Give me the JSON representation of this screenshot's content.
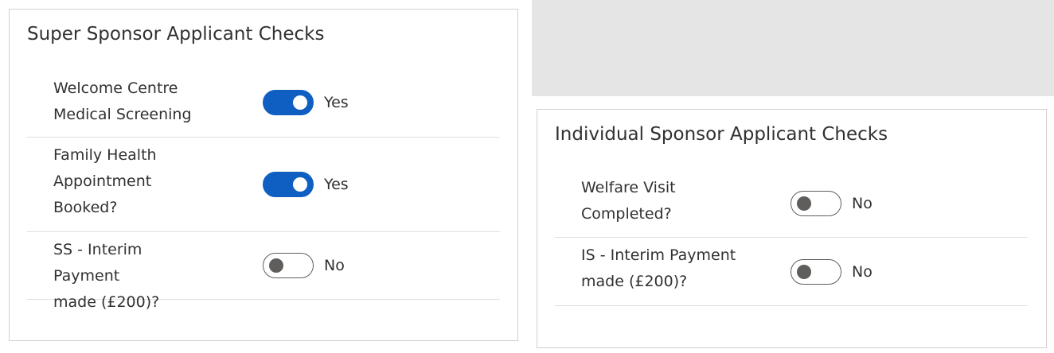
{
  "super_sponsor": {
    "title": "Super Sponsor Applicant Checks",
    "rows": [
      {
        "label_lines": [
          "Welcome Centre",
          "Medical Screening"
        ],
        "value": "Yes",
        "on": true
      },
      {
        "label_lines": [
          "Family Health",
          "Appointment",
          "Booked?"
        ],
        "value": "Yes",
        "on": true
      },
      {
        "label_lines": [
          "SS - Interim Payment",
          "made (£200)?"
        ],
        "value": "No",
        "on": false
      }
    ]
  },
  "individual_sponsor": {
    "title": "Individual Sponsor Applicant Checks",
    "rows": [
      {
        "label_lines": [
          "Welfare Visit",
          "Completed?"
        ],
        "value": "No",
        "on": false
      },
      {
        "label_lines": [
          "IS - Interim Payment",
          "made (£200)?"
        ],
        "value": "No",
        "on": false
      }
    ]
  },
  "colors": {
    "toggle_on": "#0f5fc2",
    "toggle_off_border": "#5f5e5c",
    "panel_background": "#e5e5e5"
  }
}
